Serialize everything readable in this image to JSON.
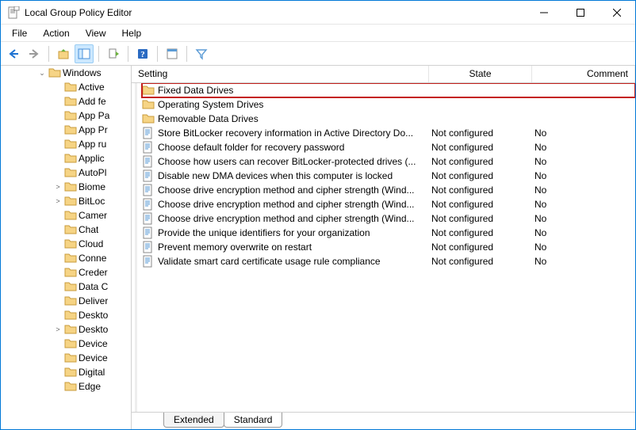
{
  "window": {
    "title": "Local Group Policy Editor"
  },
  "menu": {
    "file": "File",
    "action": "Action",
    "view": "View",
    "help": "Help"
  },
  "tree": {
    "root": "Windows",
    "items": [
      {
        "label": "Active",
        "expander": ""
      },
      {
        "label": "Add fe",
        "expander": ""
      },
      {
        "label": "App Pa",
        "expander": ""
      },
      {
        "label": "App Pr",
        "expander": ""
      },
      {
        "label": "App ru",
        "expander": ""
      },
      {
        "label": "Applic",
        "expander": ""
      },
      {
        "label": "AutoPl",
        "expander": ""
      },
      {
        "label": "Biome",
        "expander": ">"
      },
      {
        "label": "BitLoc",
        "expander": ">"
      },
      {
        "label": "Camer",
        "expander": ""
      },
      {
        "label": "Chat",
        "expander": ""
      },
      {
        "label": "Cloud",
        "expander": ""
      },
      {
        "label": "Conne",
        "expander": ""
      },
      {
        "label": "Creder",
        "expander": ""
      },
      {
        "label": "Data C",
        "expander": ""
      },
      {
        "label": "Deliver",
        "expander": ""
      },
      {
        "label": "Deskto",
        "expander": ""
      },
      {
        "label": "Deskto",
        "expander": ">"
      },
      {
        "label": "Device",
        "expander": ""
      },
      {
        "label": "Device",
        "expander": ""
      },
      {
        "label": "Digital",
        "expander": ""
      },
      {
        "label": "Edge",
        "expander": ""
      }
    ]
  },
  "list": {
    "headers": {
      "setting": "Setting",
      "state": "State",
      "comment": "Comment"
    },
    "items": [
      {
        "type": "folder",
        "setting": "Fixed Data Drives",
        "state": "",
        "comment": "",
        "highlight": true
      },
      {
        "type": "folder",
        "setting": "Operating System Drives",
        "state": "",
        "comment": ""
      },
      {
        "type": "folder",
        "setting": "Removable Data Drives",
        "state": "",
        "comment": ""
      },
      {
        "type": "policy",
        "setting": "Store BitLocker recovery information in Active Directory Do...",
        "state": "Not configured",
        "comment": "No"
      },
      {
        "type": "policy",
        "setting": "Choose default folder for recovery password",
        "state": "Not configured",
        "comment": "No"
      },
      {
        "type": "policy",
        "setting": "Choose how users can recover BitLocker-protected drives (...",
        "state": "Not configured",
        "comment": "No"
      },
      {
        "type": "policy",
        "setting": "Disable new DMA devices when this computer is locked",
        "state": "Not configured",
        "comment": "No"
      },
      {
        "type": "policy",
        "setting": "Choose drive encryption method and cipher strength (Wind...",
        "state": "Not configured",
        "comment": "No"
      },
      {
        "type": "policy",
        "setting": "Choose drive encryption method and cipher strength (Wind...",
        "state": "Not configured",
        "comment": "No"
      },
      {
        "type": "policy",
        "setting": "Choose drive encryption method and cipher strength (Wind...",
        "state": "Not configured",
        "comment": "No"
      },
      {
        "type": "policy",
        "setting": "Provide the unique identifiers for your organization",
        "state": "Not configured",
        "comment": "No"
      },
      {
        "type": "policy",
        "setting": "Prevent memory overwrite on restart",
        "state": "Not configured",
        "comment": "No"
      },
      {
        "type": "policy",
        "setting": "Validate smart card certificate usage rule compliance",
        "state": "Not configured",
        "comment": "No"
      }
    ]
  },
  "tabs": {
    "extended": "Extended",
    "standard": "Standard"
  }
}
